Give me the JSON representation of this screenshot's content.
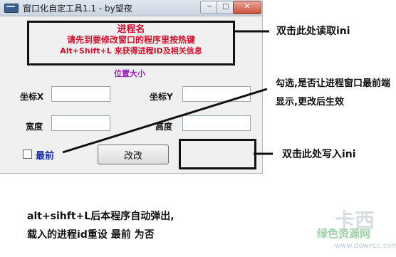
{
  "window": {
    "title": "窗口化自定工具1.1 - by望夜",
    "controls": {
      "minimize": "─",
      "maximize": "□",
      "close": "✕"
    }
  },
  "info_box": {
    "process_name": "进程名",
    "hint_line1": "请先到要修改窗口的程序里按热键",
    "hint_line2": "Alt+Shift+L 来获得进程ID及相关信息"
  },
  "section_title": "位置大小",
  "fields": {
    "x_label": "坐标X",
    "y_label": "坐标Y",
    "width_label": "宽度",
    "height_label": "高度",
    "x_value": "",
    "y_value": "",
    "width_value": "",
    "height_value": ""
  },
  "topmost": {
    "label": "最前",
    "checked": false
  },
  "modify_button": "改改",
  "annotations": {
    "read_ini": "双击此处读取ini",
    "topmost_hint": "勾选,是否让进程窗口最前端显示,更改后生效",
    "write_ini": "双击此处写入ini"
  },
  "bottom_note": {
    "line1": "alt+sihft+L后本程序自动弹出,",
    "line2": "载入的进程id重设 最前 为否"
  },
  "watermark": {
    "logo": "卡西",
    "cn": "绿色资源网",
    "url": "www.downcc.com"
  }
}
